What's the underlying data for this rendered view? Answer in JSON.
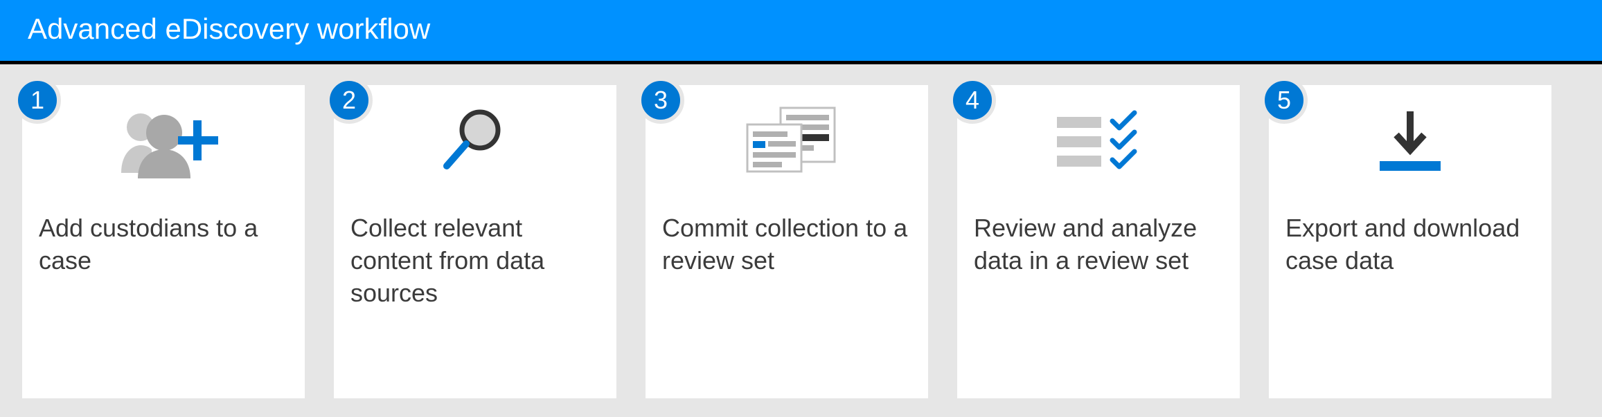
{
  "header": {
    "title": "Advanced eDiscovery workflow"
  },
  "steps": [
    {
      "number": "1",
      "icon": "add-user-icon",
      "label": "Add custodians to a case"
    },
    {
      "number": "2",
      "icon": "search-icon",
      "label": "Collect relevant content from data sources"
    },
    {
      "number": "3",
      "icon": "documents-icon",
      "label": "Commit collection to a review set"
    },
    {
      "number": "4",
      "icon": "checklist-icon",
      "label": "Review and analyze data in a review set"
    },
    {
      "number": "5",
      "icon": "download-icon",
      "label": "Export and download case data"
    }
  ],
  "colors": {
    "accent": "#0078d4",
    "header": "#0091ff"
  }
}
